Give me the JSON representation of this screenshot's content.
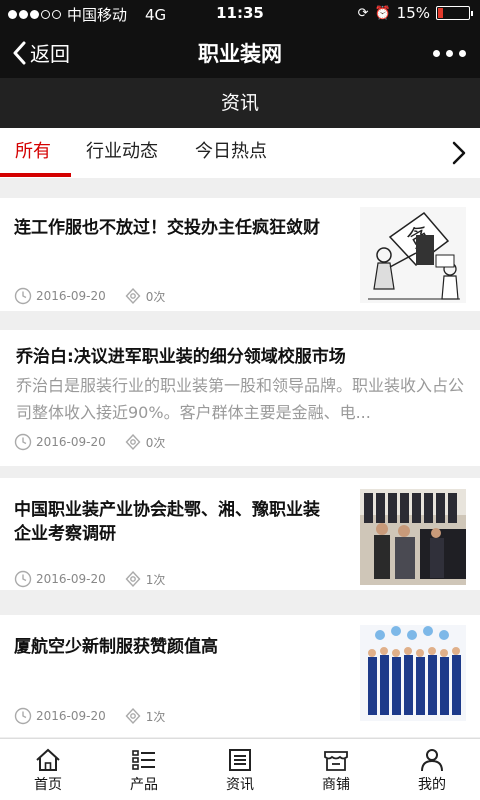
{
  "status_bar": {
    "carrier": "中国移动",
    "network": "4G",
    "time": "11:35",
    "battery_level": "15%",
    "battery_fraction": 0.15
  },
  "nav": {
    "back_label": "返回",
    "title": "职业装网"
  },
  "section_title": "资讯",
  "tabs": [
    {
      "label": "所有",
      "active": true
    },
    {
      "label": "行业动态",
      "active": false
    },
    {
      "label": "今日热点",
      "active": false
    }
  ],
  "articles": [
    {
      "title": "连工作服也不放过！交投办主任疯狂敛财",
      "date": "2016-09-20",
      "views": "0次",
      "thumb": "cartoon"
    },
    {
      "title": "乔治白:决议进军职业装的细分领域校服市场",
      "summary": "乔治白是服装行业的职业装第一股和领导品牌。职业装收入占公司整体收入接近90%。客户群体主要是金融、电...",
      "date": "2016-09-20",
      "views": "0次"
    },
    {
      "title": "中国职业装产业协会赴鄂、湘、豫职业装企业考察调研",
      "date": "2016-09-20",
      "views": "1次",
      "thumb": "store"
    },
    {
      "title": "厦航空少新制服获赞颜值高",
      "date": "2016-09-20",
      "views": "1次",
      "thumb": "crew"
    }
  ],
  "bottom_nav": [
    {
      "label": "首页",
      "icon": "home-icon"
    },
    {
      "label": "产品",
      "icon": "list-icon"
    },
    {
      "label": "资讯",
      "icon": "news-icon"
    },
    {
      "label": "商铺",
      "icon": "store-icon"
    },
    {
      "label": "我的",
      "icon": "user-icon"
    }
  ],
  "colors": {
    "accent": "#d40000",
    "header_bg": "#111111",
    "section_bg": "#222222"
  }
}
